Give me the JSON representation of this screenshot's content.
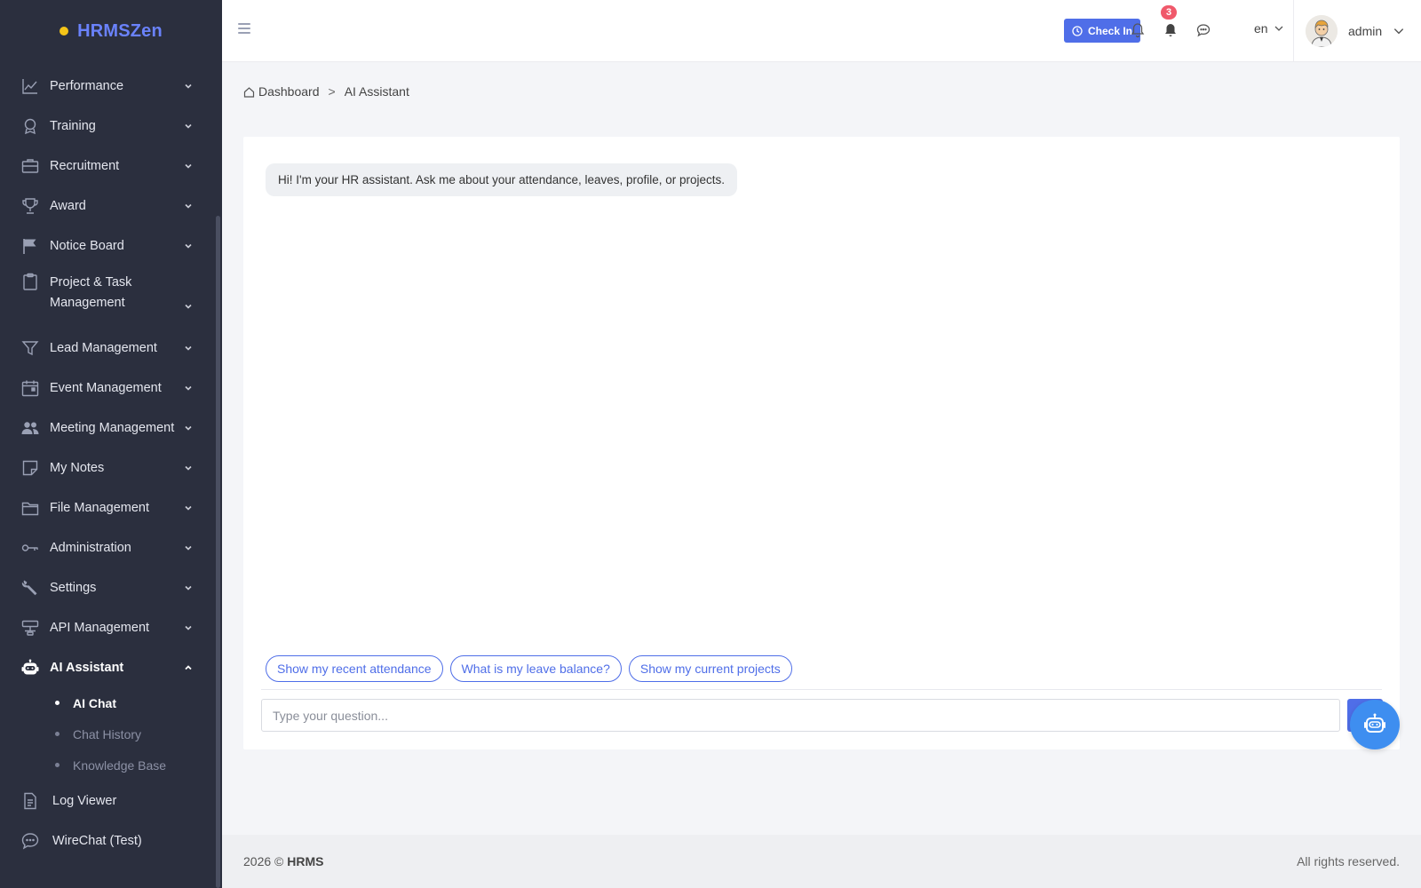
{
  "brand": {
    "name": "HRMSZen"
  },
  "sidebar": {
    "items": [
      {
        "label": "Performance",
        "icon": "chart-line-icon"
      },
      {
        "label": "Training",
        "icon": "award-ribbon-icon"
      },
      {
        "label": "Recruitment",
        "icon": "briefcase-icon"
      },
      {
        "label": "Award",
        "icon": "trophy-icon"
      },
      {
        "label": "Notice Board",
        "icon": "flag-icon"
      },
      {
        "label": "Project & Task Management",
        "icon": "clipboard-icon"
      },
      {
        "label": "Lead Management",
        "icon": "funnel-icon"
      },
      {
        "label": "Event Management",
        "icon": "calendar-icon"
      },
      {
        "label": "Meeting Management",
        "icon": "users-icon"
      },
      {
        "label": "My Notes",
        "icon": "note-icon"
      },
      {
        "label": "File Management",
        "icon": "folder-icon"
      },
      {
        "label": "Administration",
        "icon": "key-icon"
      },
      {
        "label": "Settings",
        "icon": "wrench-icon"
      },
      {
        "label": "API Management",
        "icon": "api-icon"
      },
      {
        "label": "AI Assistant",
        "icon": "robot-icon",
        "expanded": true
      }
    ],
    "sub_items": [
      {
        "label": "AI Chat",
        "active": true
      },
      {
        "label": "Chat History"
      },
      {
        "label": "Knowledge Base"
      }
    ],
    "bottom_items": [
      {
        "label": "Log Viewer",
        "icon": "document-icon"
      },
      {
        "label": "WireChat (Test)",
        "icon": "chat-bubble-icon"
      }
    ]
  },
  "header": {
    "check_in_label": "Check In",
    "notification_count": "3",
    "language": "en",
    "user_name": "admin"
  },
  "breadcrumb": {
    "home": "Dashboard",
    "separator": ">",
    "current": "AI Assistant"
  },
  "chat": {
    "greeting": "Hi! I'm your HR assistant. Ask me about your attendance, leaves, profile, or projects.",
    "suggestions": [
      "Show my recent attendance",
      "What is my leave balance?",
      "Show my current projects"
    ],
    "input_placeholder": "Type your question..."
  },
  "footer": {
    "year": "2026 ©",
    "brand": "HRMS",
    "rights": "All rights reserved."
  },
  "colors": {
    "sidebar_bg": "#2b2f3e",
    "accent": "#4f6ee8",
    "brand_text": "#6a82fb",
    "badge": "#f0596b",
    "fab": "#3e8ef0"
  }
}
